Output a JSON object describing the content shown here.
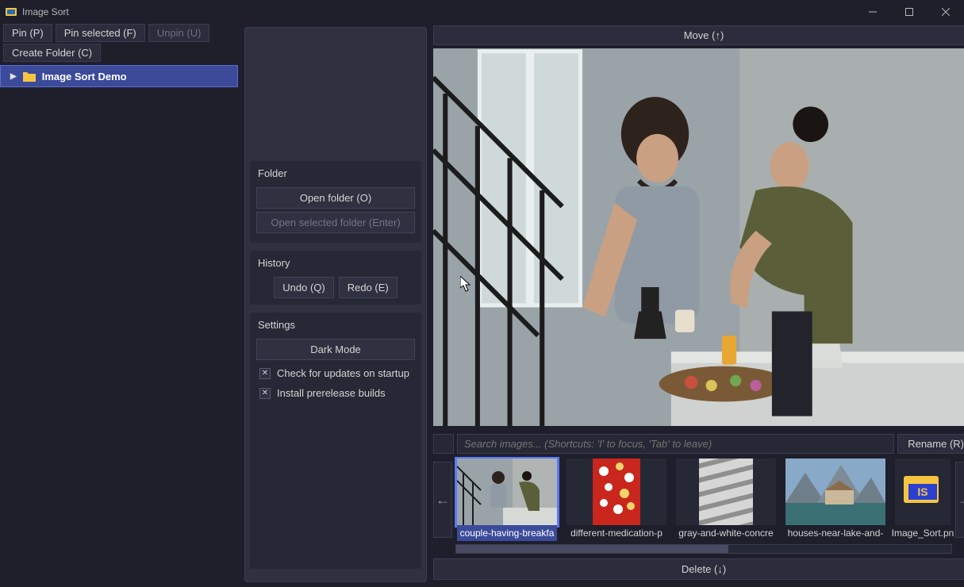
{
  "window": {
    "title": "Image Sort"
  },
  "left": {
    "pin": "Pin (P)",
    "pin_selected": "Pin selected (F)",
    "unpin": "Unpin (U)",
    "create_folder": "Create Folder (C)",
    "tree_item": "Image Sort Demo"
  },
  "middle": {
    "folder": {
      "header": "Folder",
      "open": "Open folder (O)",
      "open_selected": "Open selected folder (Enter)"
    },
    "history": {
      "header": "History",
      "undo": "Undo (Q)",
      "redo": "Redo (E)"
    },
    "settings": {
      "header": "Settings",
      "dark_mode": "Dark Mode",
      "updates": "Check for updates on startup",
      "prerelease": "Install prerelease builds"
    }
  },
  "right": {
    "move": "Move (↑)",
    "search_placeholder": "Search images... (Shortcuts: 'I' to focus, 'Tab' to leave)",
    "rename": "Rename (R)",
    "delete": "Delete (↓)",
    "prev": "←",
    "next": "→",
    "thumbs": [
      {
        "label": "couple-having-breakfa",
        "selected": true
      },
      {
        "label": "different-medication-p",
        "selected": false
      },
      {
        "label": "gray-and-white-concre",
        "selected": false
      },
      {
        "label": "houses-near-lake-and-",
        "selected": false
      },
      {
        "label": "Image_Sort.pn",
        "selected": false
      }
    ]
  }
}
